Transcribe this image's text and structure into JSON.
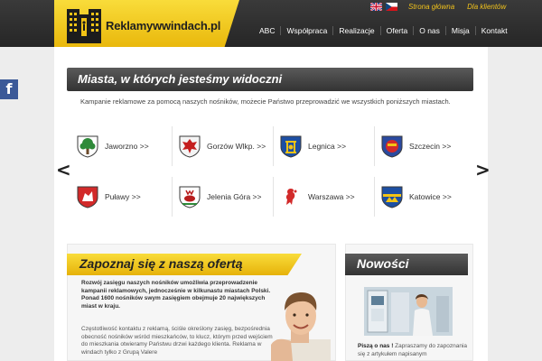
{
  "header": {
    "logo_text": "Reklamywwindach.pl",
    "toplinks": [
      "Strona główna",
      "Dla klientów"
    ],
    "languages": [
      "en-flag-icon",
      "cz-flag-icon"
    ],
    "nav": [
      "ABC",
      "Współpraca",
      "Realizacje",
      "Oferta",
      "O nas",
      "Misja",
      "Kontakt"
    ]
  },
  "social": {
    "facebook_glyph": "f"
  },
  "cities_section": {
    "title": "Miasta, w których jesteśmy widoczni",
    "intro": "Kampanie reklamowe za pomocą naszych nośników, możecie Państwo przeprowadzić we wszystkich poniższych miastach.",
    "prev_arrow": "<",
    "next_arrow": ">",
    "cities": [
      {
        "name": "Jaworzno >>",
        "icon": "jaworzno-crest-icon"
      },
      {
        "name": "Gorzów Wlkp. >>",
        "icon": "gorzow-crest-icon"
      },
      {
        "name": "Legnica >>",
        "icon": "legnica-crest-icon"
      },
      {
        "name": "Szczecin >>",
        "icon": "szczecin-crest-icon"
      },
      {
        "name": "Puławy >>",
        "icon": "pulawy-crest-icon"
      },
      {
        "name": "Jelenia Góra >>",
        "icon": "jelenia-gora-crest-icon"
      },
      {
        "name": "Warszawa >>",
        "icon": "warszawa-crest-icon"
      },
      {
        "name": "Katowice >>",
        "icon": "katowice-crest-icon"
      }
    ]
  },
  "offer": {
    "title": "Zapoznaj się z naszą ofertą",
    "bold_text": "Rozwój zasięgu naszych nośników umożliwia przeprowadzenie kampanii reklamowych, jednocześnie w kilkunastu miastach Polski. Ponad 1600 nośników swym zasięgiem obejmuje 20 największych miast w kraju.",
    "text": "Częstotliwość kontaktu z reklamą, ściśle określony zasięg, bezpośrednia obecność nośników wśród mieszkańców, to klucz, którym przed wejściem do mieszkania otwieramy Państwu drzwi każdego klienta. Reklama w windach tylko z Grupą Valere"
  },
  "news": {
    "title": "Nowości",
    "headline": "Piszą o nas !",
    "text": " Zapraszamy do zapoznania się z artykułem napisanym"
  },
  "colors": {
    "accent": "#f2c315",
    "dark": "#2e2e2e"
  }
}
